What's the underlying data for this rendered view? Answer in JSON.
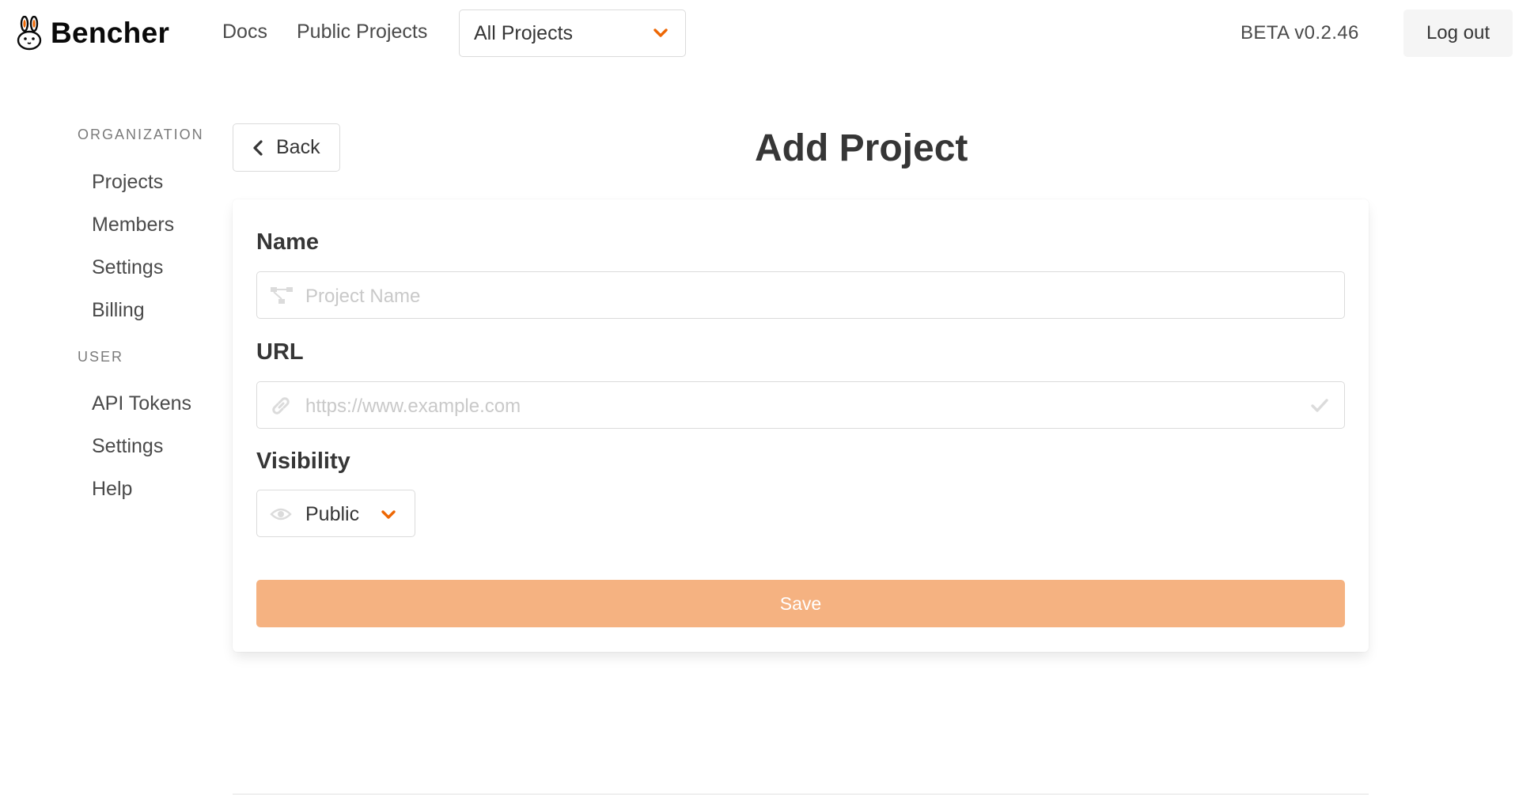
{
  "navbar": {
    "brand": "Bencher",
    "links": {
      "docs": "Docs",
      "public_projects": "Public Projects"
    },
    "project_select": "All Projects",
    "version": "BETA v0.2.46",
    "logout": "Log out"
  },
  "sidebar": {
    "organization_label": "ORGANIZATION",
    "organization_items": [
      "Projects",
      "Members",
      "Settings",
      "Billing"
    ],
    "user_label": "USER",
    "user_items": [
      "API Tokens",
      "Settings",
      "Help"
    ]
  },
  "main": {
    "back": "Back",
    "title": "Add Project",
    "form": {
      "name_label": "Name",
      "name_placeholder": "Project Name",
      "url_label": "URL",
      "url_placeholder": "https://www.example.com",
      "visibility_label": "Visibility",
      "visibility_value": "Public",
      "save": "Save"
    }
  },
  "icons": {
    "brand": "rabbit-logo-icon",
    "name_field": "project-diagram-icon",
    "url_field": "link-icon",
    "url_valid": "check-icon",
    "visibility": "eye-icon",
    "dropdown": "chevron-down-icon",
    "back": "chevron-left-icon"
  },
  "colors": {
    "accent": "#ed6704",
    "save_button": "#f5b281",
    "text": "#363636",
    "muted": "#7a7a7a"
  }
}
